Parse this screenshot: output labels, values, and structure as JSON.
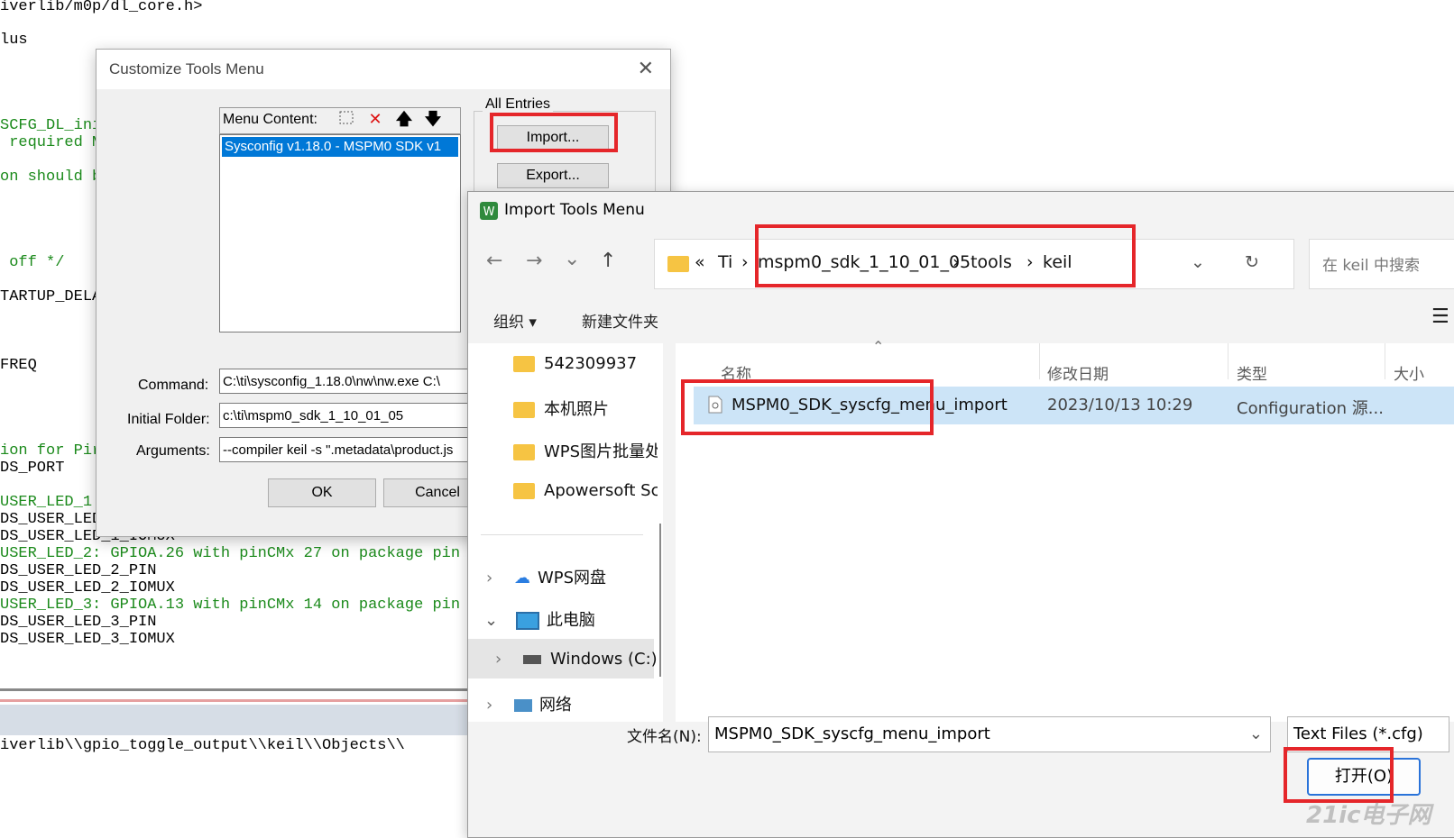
{
  "editor": {
    "lines": [
      {
        "text": "iverlib/m0p/dl_core.h>",
        "color": "black"
      },
      {
        "text": "lus",
        "color": "black"
      },
      {
        "text": "SCFG_DL_ini",
        "color": "green"
      },
      {
        "text": " required M",
        "color": "green"
      },
      {
        "text": "on should b",
        "color": "green"
      },
      {
        "text": " off */",
        "color": "green"
      },
      {
        "text": "TARTUP_DELA",
        "color": "black"
      },
      {
        "text": "FREQ",
        "color": "black"
      },
      {
        "text": "ion for Pir",
        "color": "green"
      },
      {
        "text": "DS_PORT",
        "color": "black"
      },
      {
        "text": "USER_LED_1:",
        "color": "green"
      },
      {
        "text": "DS_USER_LED_1_PIN",
        "color": "black"
      },
      {
        "text": "DS_USER_LED_1_IOMUX",
        "color": "black"
      },
      {
        "text": "USER_LED_2: GPIOA.26 with pinCMx 27 on package pin",
        "color": "green"
      },
      {
        "text": "DS_USER_LED_2_PIN",
        "color": "black"
      },
      {
        "text": "DS_USER_LED_2_IOMUX",
        "color": "black"
      },
      {
        "text": "USER_LED_3: GPIOA.13 with pinCMx 14 on package pin",
        "color": "green"
      },
      {
        "text": "DS_USER_LED_3_PIN",
        "color": "black"
      },
      {
        "text": "DS_USER_LED_3_IOMUX",
        "color": "black"
      }
    ],
    "build_output": "iverlib\\\\gpio_toggle_output\\\\keil\\\\Objects\\\\"
  },
  "customize_dialog": {
    "title": "Customize Tools Menu",
    "close_glyph": "✕",
    "menu_content_label": "Menu Content:",
    "menu_items": [
      "Sysconfig v1.18.0 - MSPM0 SDK v1"
    ],
    "all_entries_label": "All Entries",
    "import_button": "Import...",
    "export_button": "Export...",
    "command_label": "Command:",
    "command_value": "C:\\ti\\sysconfig_1.18.0\\nw\\nw.exe C:\\",
    "initial_folder_label": "Initial Folder:",
    "initial_folder_value": "c:\\ti\\mspm0_sdk_1_10_01_05",
    "arguments_label": "Arguments:",
    "arguments_value": "--compiler keil -s \".metadata\\product.js",
    "ok_button": "OK",
    "cancel_button": "Cancel"
  },
  "import_dialog": {
    "title": "Import Tools Menu",
    "nav": {
      "back": "←",
      "forward": "→",
      "recent": "⌄",
      "up": "↑"
    },
    "breadcrumb": {
      "overflow": "«",
      "items": [
        "Ti",
        "mspm0_sdk_1_10_01_05",
        "tools",
        "keil"
      ],
      "separator": "›"
    },
    "refresh_glyph": "↻",
    "search_placeholder": "在 keil 中搜索",
    "commands": {
      "organize": "组织 ▾",
      "new_folder": "新建文件夹"
    },
    "sidebar": [
      {
        "label": "542309937",
        "icon": "folder-icon"
      },
      {
        "label": "本机照片",
        "icon": "folder-icon"
      },
      {
        "label": "WPS图片批量处",
        "icon": "folder-icon"
      },
      {
        "label": "Apowersoft Sc",
        "icon": "folder-icon"
      },
      {
        "label": "WPS网盘",
        "icon": "cloud-icon"
      },
      {
        "label": "此电脑",
        "icon": "computer-icon"
      },
      {
        "label": "Windows (C:)",
        "icon": "drive-icon"
      },
      {
        "label": "网络",
        "icon": "network-icon"
      }
    ],
    "columns": {
      "name": "名称",
      "date": "修改日期",
      "type": "类型",
      "size": "大小"
    },
    "files": [
      {
        "name": "MSPM0_SDK_syscfg_menu_import",
        "date": "2023/10/13 10:29",
        "type": "Configuration 源..."
      }
    ],
    "filename_label": "文件名(N):",
    "filename_value": "MSPM0_SDK_syscfg_menu_import",
    "filetype_value": "Text Files (*.cfg)",
    "open_button": "打开(O)"
  },
  "watermark": "21ic电子网",
  "colors": {
    "highlight_red": "#e5262a",
    "selection_blue": "#cce4f7",
    "list_selection": "#0078d7",
    "code_green": "#1b8a1b"
  }
}
